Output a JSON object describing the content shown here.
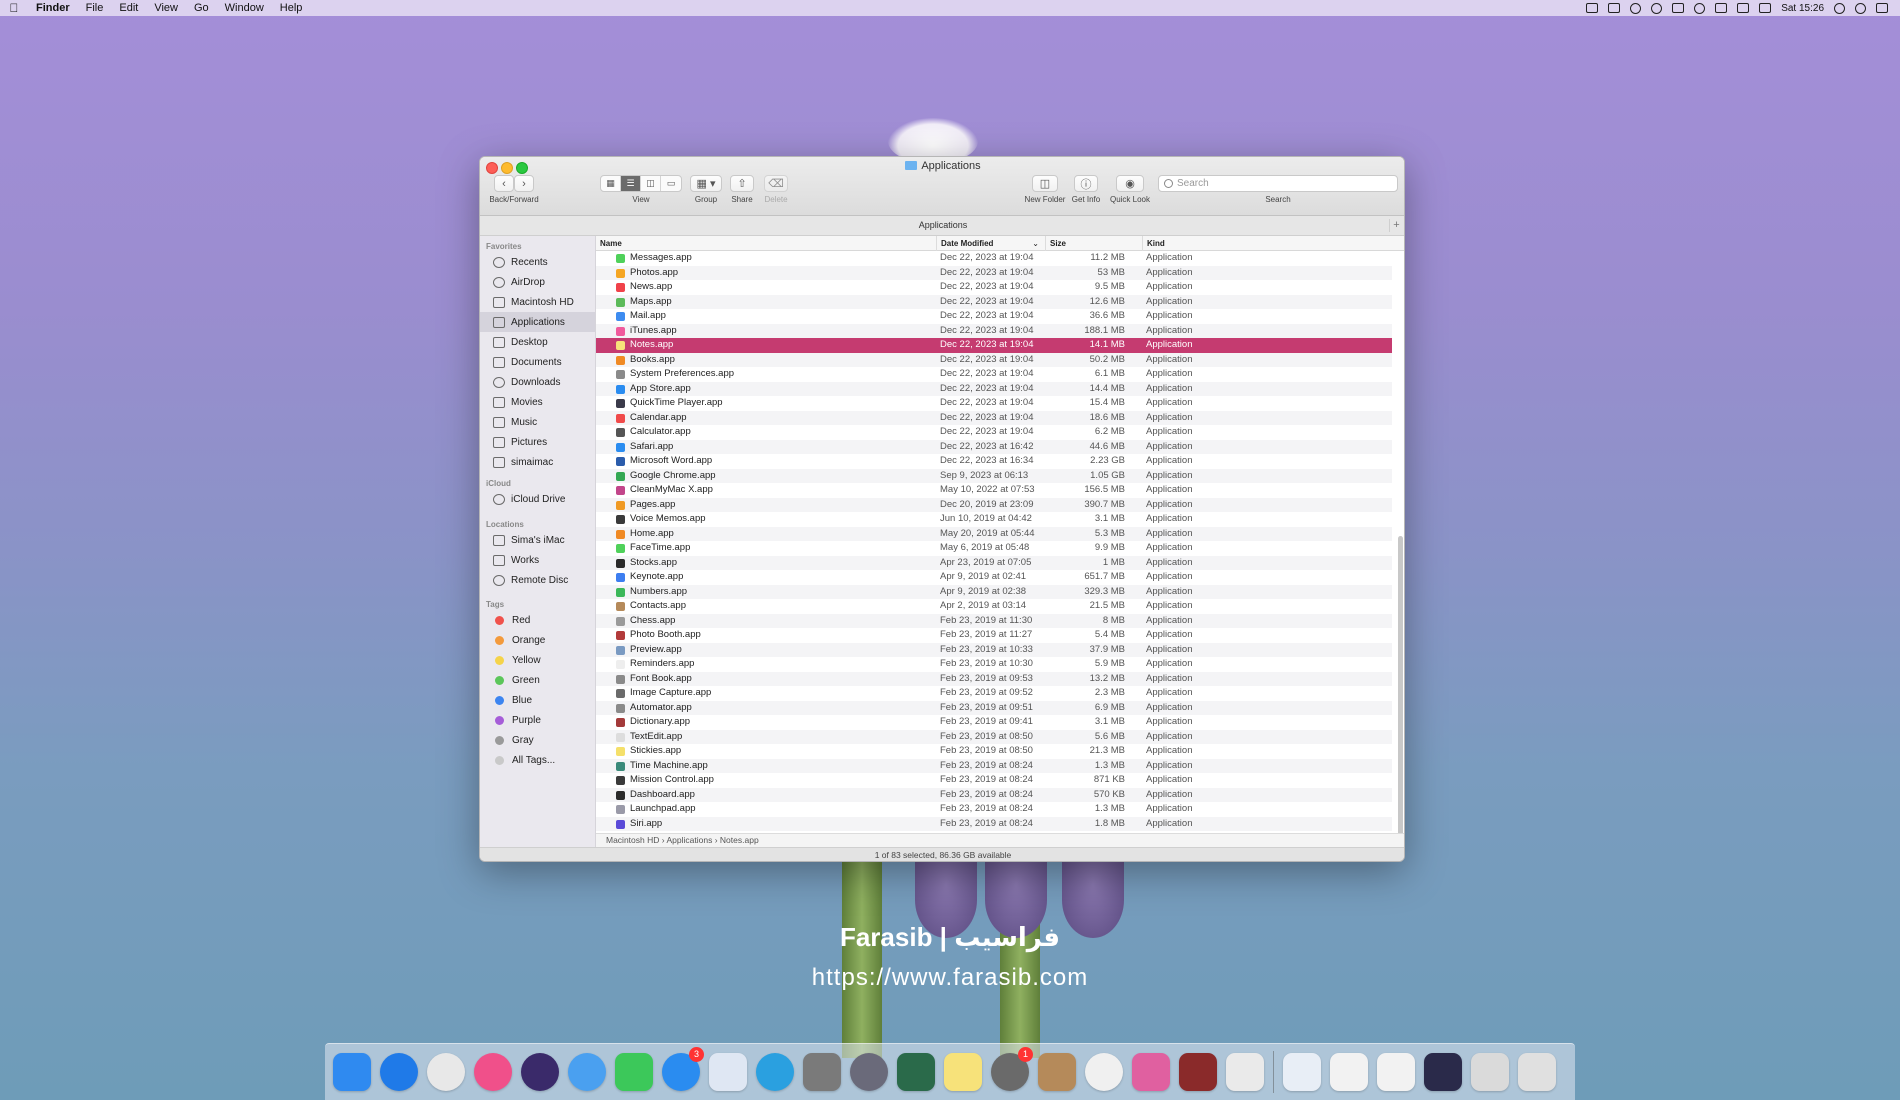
{
  "menubar": {
    "app": "Finder",
    "items": [
      "File",
      "Edit",
      "View",
      "Go",
      "Window",
      "Help"
    ],
    "clock": "Sat 15:26"
  },
  "watermark": {
    "line1": "Farasib | فراسيب",
    "line2": "https://www.farasib.com"
  },
  "window": {
    "title": "Applications",
    "toolbar": {
      "back_forward": "Back/Forward",
      "view": "View",
      "group": "Group",
      "share": "Share",
      "delete": "Delete",
      "new_folder": "New Folder",
      "get_info": "Get Info",
      "quick_look": "Quick Look",
      "search_label": "Search",
      "search_placeholder": "Search"
    },
    "path_title": "Applications",
    "columns": {
      "name": "Name",
      "date": "Date Modified",
      "size": "Size",
      "kind": "Kind"
    },
    "sidebar": {
      "favorites_header": "Favorites",
      "favorites": [
        "Recents",
        "AirDrop",
        "Macintosh HD",
        "Applications",
        "Desktop",
        "Documents",
        "Downloads",
        "Movies",
        "Music",
        "Pictures",
        "simaimac"
      ],
      "icloud_header": "iCloud",
      "icloud": [
        "iCloud Drive"
      ],
      "locations_header": "Locations",
      "locations": [
        "Sima's iMac",
        "Works",
        "Remote Disc"
      ],
      "tags_header": "Tags",
      "tags": [
        {
          "label": "Red",
          "color": "#f0524c"
        },
        {
          "label": "Orange",
          "color": "#f39a3c"
        },
        {
          "label": "Yellow",
          "color": "#f5d34a"
        },
        {
          "label": "Green",
          "color": "#5cc65a"
        },
        {
          "label": "Blue",
          "color": "#3d85f0"
        },
        {
          "label": "Purple",
          "color": "#a65dd8"
        },
        {
          "label": "Gray",
          "color": "#9a9a9a"
        },
        {
          "label": "All Tags...",
          "color": "#c9c9c9"
        }
      ]
    },
    "files": [
      {
        "name": "Messages.app",
        "date": "Dec 22, 2023 at 19:04",
        "size": "11.2 MB",
        "kind": "Application",
        "color": "#4fd15a"
      },
      {
        "name": "Photos.app",
        "date": "Dec 22, 2023 at 19:04",
        "size": "53 MB",
        "kind": "Application",
        "color": "#f5a623"
      },
      {
        "name": "News.app",
        "date": "Dec 22, 2023 at 19:04",
        "size": "9.5 MB",
        "kind": "Application",
        "color": "#f0424a"
      },
      {
        "name": "Maps.app",
        "date": "Dec 22, 2023 at 19:04",
        "size": "12.6 MB",
        "kind": "Application",
        "color": "#5cba5a"
      },
      {
        "name": "Mail.app",
        "date": "Dec 22, 2023 at 19:04",
        "size": "36.6 MB",
        "kind": "Application",
        "color": "#3d8cf0"
      },
      {
        "name": "iTunes.app",
        "date": "Dec 22, 2023 at 19:04",
        "size": "188.1 MB",
        "kind": "Application",
        "color": "#f05a9c"
      },
      {
        "name": "Notes.app",
        "date": "Dec 22, 2023 at 19:04",
        "size": "14.1 MB",
        "kind": "Application",
        "color": "#f7e27a"
      },
      {
        "name": "Books.app",
        "date": "Dec 22, 2023 at 19:04",
        "size": "50.2 MB",
        "kind": "Application",
        "color": "#f08a24"
      },
      {
        "name": "System Preferences.app",
        "date": "Dec 22, 2023 at 19:04",
        "size": "6.1 MB",
        "kind": "Application",
        "color": "#8a8a8a"
      },
      {
        "name": "App Store.app",
        "date": "Dec 22, 2023 at 19:04",
        "size": "14.4 MB",
        "kind": "Application",
        "color": "#2a8cf0"
      },
      {
        "name": "QuickTime Player.app",
        "date": "Dec 22, 2023 at 19:04",
        "size": "15.4 MB",
        "kind": "Application",
        "color": "#3a3a4a"
      },
      {
        "name": "Calendar.app",
        "date": "Dec 22, 2023 at 19:04",
        "size": "18.6 MB",
        "kind": "Application",
        "color": "#f04a4a"
      },
      {
        "name": "Calculator.app",
        "date": "Dec 22, 2023 at 19:04",
        "size": "6.2 MB",
        "kind": "Application",
        "color": "#555555"
      },
      {
        "name": "Safari.app",
        "date": "Dec 22, 2023 at 16:42",
        "size": "44.6 MB",
        "kind": "Application",
        "color": "#2a8cf0"
      },
      {
        "name": "Microsoft Word.app",
        "date": "Dec 22, 2023 at 16:34",
        "size": "2.23 GB",
        "kind": "Application",
        "color": "#2b5cab"
      },
      {
        "name": "Google Chrome.app",
        "date": "Sep 9, 2023 at 06:13",
        "size": "1.05 GB",
        "kind": "Application",
        "color": "#34a853"
      },
      {
        "name": "CleanMyMac X.app",
        "date": "May 10, 2022 at 07:53",
        "size": "156.5 MB",
        "kind": "Application",
        "color": "#c2458a"
      },
      {
        "name": "Pages.app",
        "date": "Dec 20, 2019 at 23:09",
        "size": "390.7 MB",
        "kind": "Application",
        "color": "#f09a24"
      },
      {
        "name": "Voice Memos.app",
        "date": "Jun 10, 2019 at 04:42",
        "size": "3.1 MB",
        "kind": "Application",
        "color": "#3a3a3a"
      },
      {
        "name": "Home.app",
        "date": "May 20, 2019 at 05:44",
        "size": "5.3 MB",
        "kind": "Application",
        "color": "#f08a24"
      },
      {
        "name": "FaceTime.app",
        "date": "May 6, 2019 at 05:48",
        "size": "9.9 MB",
        "kind": "Application",
        "color": "#4fd15a"
      },
      {
        "name": "Stocks.app",
        "date": "Apr 23, 2019 at 07:05",
        "size": "1 MB",
        "kind": "Application",
        "color": "#2a2a2a"
      },
      {
        "name": "Keynote.app",
        "date": "Apr 9, 2019 at 02:41",
        "size": "651.7 MB",
        "kind": "Application",
        "color": "#3d7ef0"
      },
      {
        "name": "Numbers.app",
        "date": "Apr 9, 2019 at 02:38",
        "size": "329.3 MB",
        "kind": "Application",
        "color": "#3cb85a"
      },
      {
        "name": "Contacts.app",
        "date": "Apr 2, 2019 at 03:14",
        "size": "21.5 MB",
        "kind": "Application",
        "color": "#b58a5a"
      },
      {
        "name": "Chess.app",
        "date": "Feb 23, 2019 at 11:30",
        "size": "8 MB",
        "kind": "Application",
        "color": "#9a9a9a"
      },
      {
        "name": "Photo Booth.app",
        "date": "Feb 23, 2019 at 11:27",
        "size": "5.4 MB",
        "kind": "Application",
        "color": "#b23a3a"
      },
      {
        "name": "Preview.app",
        "date": "Feb 23, 2019 at 10:33",
        "size": "37.9 MB",
        "kind": "Application",
        "color": "#7a9ac2"
      },
      {
        "name": "Reminders.app",
        "date": "Feb 23, 2019 at 10:30",
        "size": "5.9 MB",
        "kind": "Application",
        "color": "#eeeeee"
      },
      {
        "name": "Font Book.app",
        "date": "Feb 23, 2019 at 09:53",
        "size": "13.2 MB",
        "kind": "Application",
        "color": "#8a8a8a"
      },
      {
        "name": "Image Capture.app",
        "date": "Feb 23, 2019 at 09:52",
        "size": "2.3 MB",
        "kind": "Application",
        "color": "#6a6a6a"
      },
      {
        "name": "Automator.app",
        "date": "Feb 23, 2019 at 09:51",
        "size": "6.9 MB",
        "kind": "Application",
        "color": "#8a8a8a"
      },
      {
        "name": "Dictionary.app",
        "date": "Feb 23, 2019 at 09:41",
        "size": "3.1 MB",
        "kind": "Application",
        "color": "#a33a3a"
      },
      {
        "name": "TextEdit.app",
        "date": "Feb 23, 2019 at 08:50",
        "size": "5.6 MB",
        "kind": "Application",
        "color": "#dddddd"
      },
      {
        "name": "Stickies.app",
        "date": "Feb 23, 2019 at 08:50",
        "size": "21.3 MB",
        "kind": "Application",
        "color": "#f5e06a"
      },
      {
        "name": "Time Machine.app",
        "date": "Feb 23, 2019 at 08:24",
        "size": "1.3 MB",
        "kind": "Application",
        "color": "#3a8a7a"
      },
      {
        "name": "Mission Control.app",
        "date": "Feb 23, 2019 at 08:24",
        "size": "871 KB",
        "kind": "Application",
        "color": "#3a3a3a"
      },
      {
        "name": "Dashboard.app",
        "date": "Feb 23, 2019 at 08:24",
        "size": "570 KB",
        "kind": "Application",
        "color": "#2a2a2a"
      },
      {
        "name": "Launchpad.app",
        "date": "Feb 23, 2019 at 08:24",
        "size": "1.3 MB",
        "kind": "Application",
        "color": "#9a9aa8"
      },
      {
        "name": "Siri.app",
        "date": "Feb 23, 2019 at 08:24",
        "size": "1.8 MB",
        "kind": "Application",
        "color": "#5a4ad8"
      }
    ],
    "selected_index": 6,
    "breadcrumbs": [
      "Macintosh HD",
      "Applications",
      "Notes.app"
    ],
    "status": "1 of 83 selected, 86.36 GB available"
  },
  "dock": {
    "apps": [
      {
        "name": "finder-icon",
        "color": "#2f8af0",
        "round": false
      },
      {
        "name": "safari-icon",
        "color": "#1f7ae8",
        "round": true
      },
      {
        "name": "chrome-icon",
        "color": "#e8e8e8",
        "round": true
      },
      {
        "name": "itunes-icon",
        "color": "#f0508a",
        "round": true
      },
      {
        "name": "siri-icon",
        "color": "#3a2a6a",
        "round": true
      },
      {
        "name": "messages-icon",
        "color": "#4aa0f0",
        "round": true
      },
      {
        "name": "facetime-icon",
        "color": "#3cc85a",
        "round": false
      },
      {
        "name": "app-store-icon",
        "color": "#2a8cf0",
        "round": true,
        "badge": "3"
      },
      {
        "name": "keynote-icon",
        "color": "#dfe7f3",
        "round": false
      },
      {
        "name": "telegram-icon",
        "color": "#2aa0e0",
        "round": true
      },
      {
        "name": "utility-icon",
        "color": "#7a7a7a",
        "round": false
      },
      {
        "name": "launchpad-icon",
        "color": "#6a6a7a",
        "round": true
      },
      {
        "name": "facetime-video-icon",
        "color": "#2a6a4a",
        "round": false
      },
      {
        "name": "notes-icon",
        "color": "#f7e27a",
        "round": false
      },
      {
        "name": "system-preferences-icon",
        "color": "#6a6a6a",
        "round": true,
        "badge": "1"
      },
      {
        "name": "contacts-icon",
        "color": "#b58a5a",
        "round": false
      },
      {
        "name": "photos-icon",
        "color": "#f0f0f0",
        "round": true
      },
      {
        "name": "cleanmymac-icon",
        "color": "#e060a0",
        "round": false
      },
      {
        "name": "photo-booth-icon",
        "color": "#8a2a2a",
        "round": false
      },
      {
        "name": "preview-icon",
        "color": "#eaeaea",
        "round": false
      }
    ],
    "docs": [
      {
        "name": "document-1-icon",
        "color": "#e8eef6"
      },
      {
        "name": "document-2-icon",
        "color": "#f2f2f2"
      },
      {
        "name": "document-3-icon",
        "color": "#f2f2f2"
      },
      {
        "name": "screenshot-icon",
        "color": "#2a2a4a"
      },
      {
        "name": "display-icon",
        "color": "#dadada"
      },
      {
        "name": "trash-icon",
        "color": "#e0e0e0"
      }
    ]
  }
}
